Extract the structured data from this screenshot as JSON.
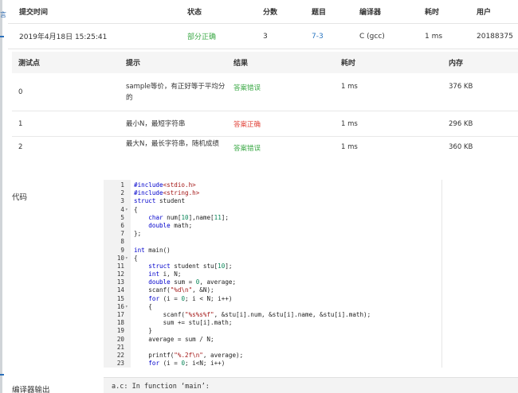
{
  "submission": {
    "headers": [
      "提交时间",
      "状态",
      "分数",
      "题目",
      "编译器",
      "耗时",
      "用户"
    ],
    "row": {
      "time": "2019年4月18日 15:25:41",
      "status": "部分正确",
      "score": "3",
      "problem": "7-3",
      "compiler": "C (gcc)",
      "elapsed": "1 ms",
      "user": "20188375"
    }
  },
  "testcases": {
    "headers": [
      "测试点",
      "提示",
      "结果",
      "耗时",
      "内存"
    ],
    "rows": [
      {
        "id": "0",
        "hint": "sample等价，有正好等于平均分的",
        "result": "答案错误",
        "time": "1 ms",
        "memory": "376 KB"
      },
      {
        "id": "1",
        "hint": "最小N，最短字符串",
        "result": "答案正确",
        "time": "1 ms",
        "memory": "296 KB"
      },
      {
        "id": "2",
        "hint": "最大N，最长字符串，随机成绩",
        "result": "答案错误",
        "time": "1 ms",
        "memory": "360 KB"
      }
    ]
  },
  "code_section": {
    "label": "代码",
    "lines": [
      "#include<stdio.h>",
      "#include<string.h>",
      "struct student",
      "{",
      "    char num[10],name[11];",
      "    double math;",
      "};",
      "",
      "int main()",
      "{",
      "    struct student stu[10];",
      "    int i, N;",
      "    double sum = 0, average;",
      "    scanf(\"%d\\n\", &N);",
      "    for (i = 0; i < N; i++)",
      "    {",
      "        scanf(\"%s%s%f\", &stu[i].num, &stu[i].name, &stu[i].math);",
      "        sum += stu[i].math;",
      "    }",
      "    average = sum / N;",
      "",
      "    printf(\"%.2f\\n\", average);",
      "    for (i = 0; i<N; i++)"
    ],
    "fold_lines": [
      4,
      10,
      16
    ]
  },
  "compiler_output": {
    "label": "编译器输出",
    "text": "a.c: In function ‘main’:"
  },
  "colors": {
    "accent": "#2b77c2",
    "correct": "#e1453b",
    "wrong": "#3aa845"
  }
}
